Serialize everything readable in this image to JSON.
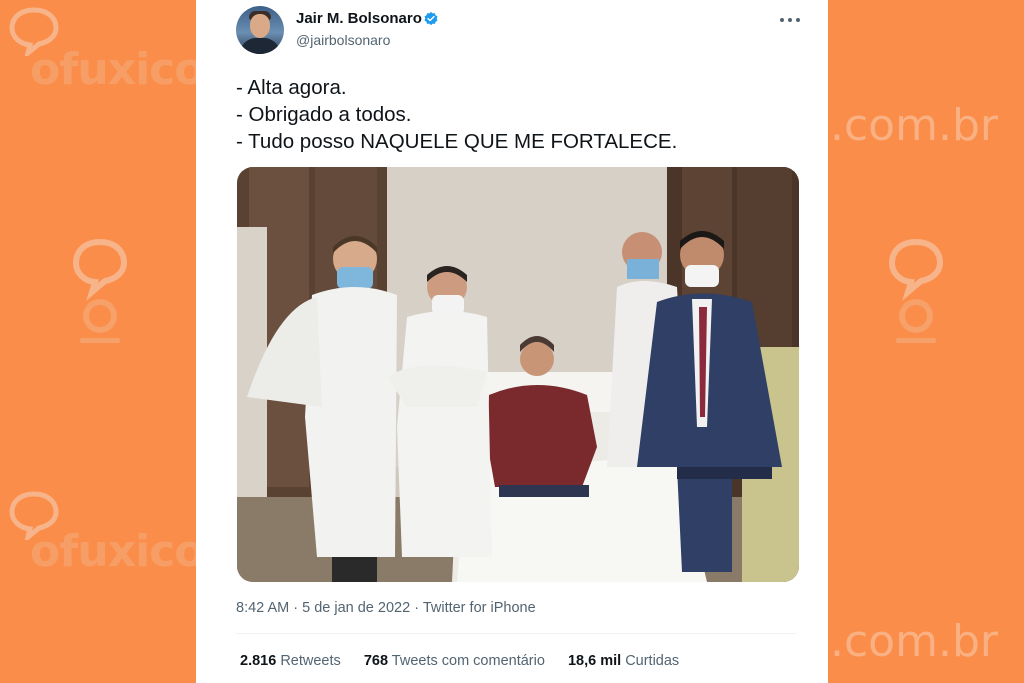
{
  "watermark": {
    "brand": "ofuxico",
    "domain": ".com.br",
    "logo_icon": "ofuxico-speech-logo",
    "colors": {
      "background": "#fa8d4a",
      "mark": "#f7a66f"
    }
  },
  "tweet": {
    "author": {
      "name": "Jair M. Bolsonaro",
      "handle": "@jairbolsonaro",
      "verified_icon": "verified-badge-icon",
      "avatar_icon": "profile-avatar"
    },
    "more_icon": "more-options-icon",
    "text_lines": [
      "- Alta agora.",
      "- Obrigado a todos.",
      "- Tudo posso NAQUELE QUE ME FORTALECE."
    ],
    "photo": {
      "icon": "hospital-room-photo"
    },
    "time": "8:42 AM",
    "date": "5 de jan de 2022",
    "separator": "·",
    "source": "Twitter for iPhone",
    "stats": [
      {
        "count": "2.816",
        "label": "Retweets"
      },
      {
        "count": "768",
        "label": "Tweets com comentário"
      },
      {
        "count": "18,6 mil",
        "label": "Curtidas"
      }
    ],
    "colors": {
      "primary_text": "#0f1419",
      "secondary_text": "#536471",
      "verified": "#1d9bf0"
    }
  }
}
